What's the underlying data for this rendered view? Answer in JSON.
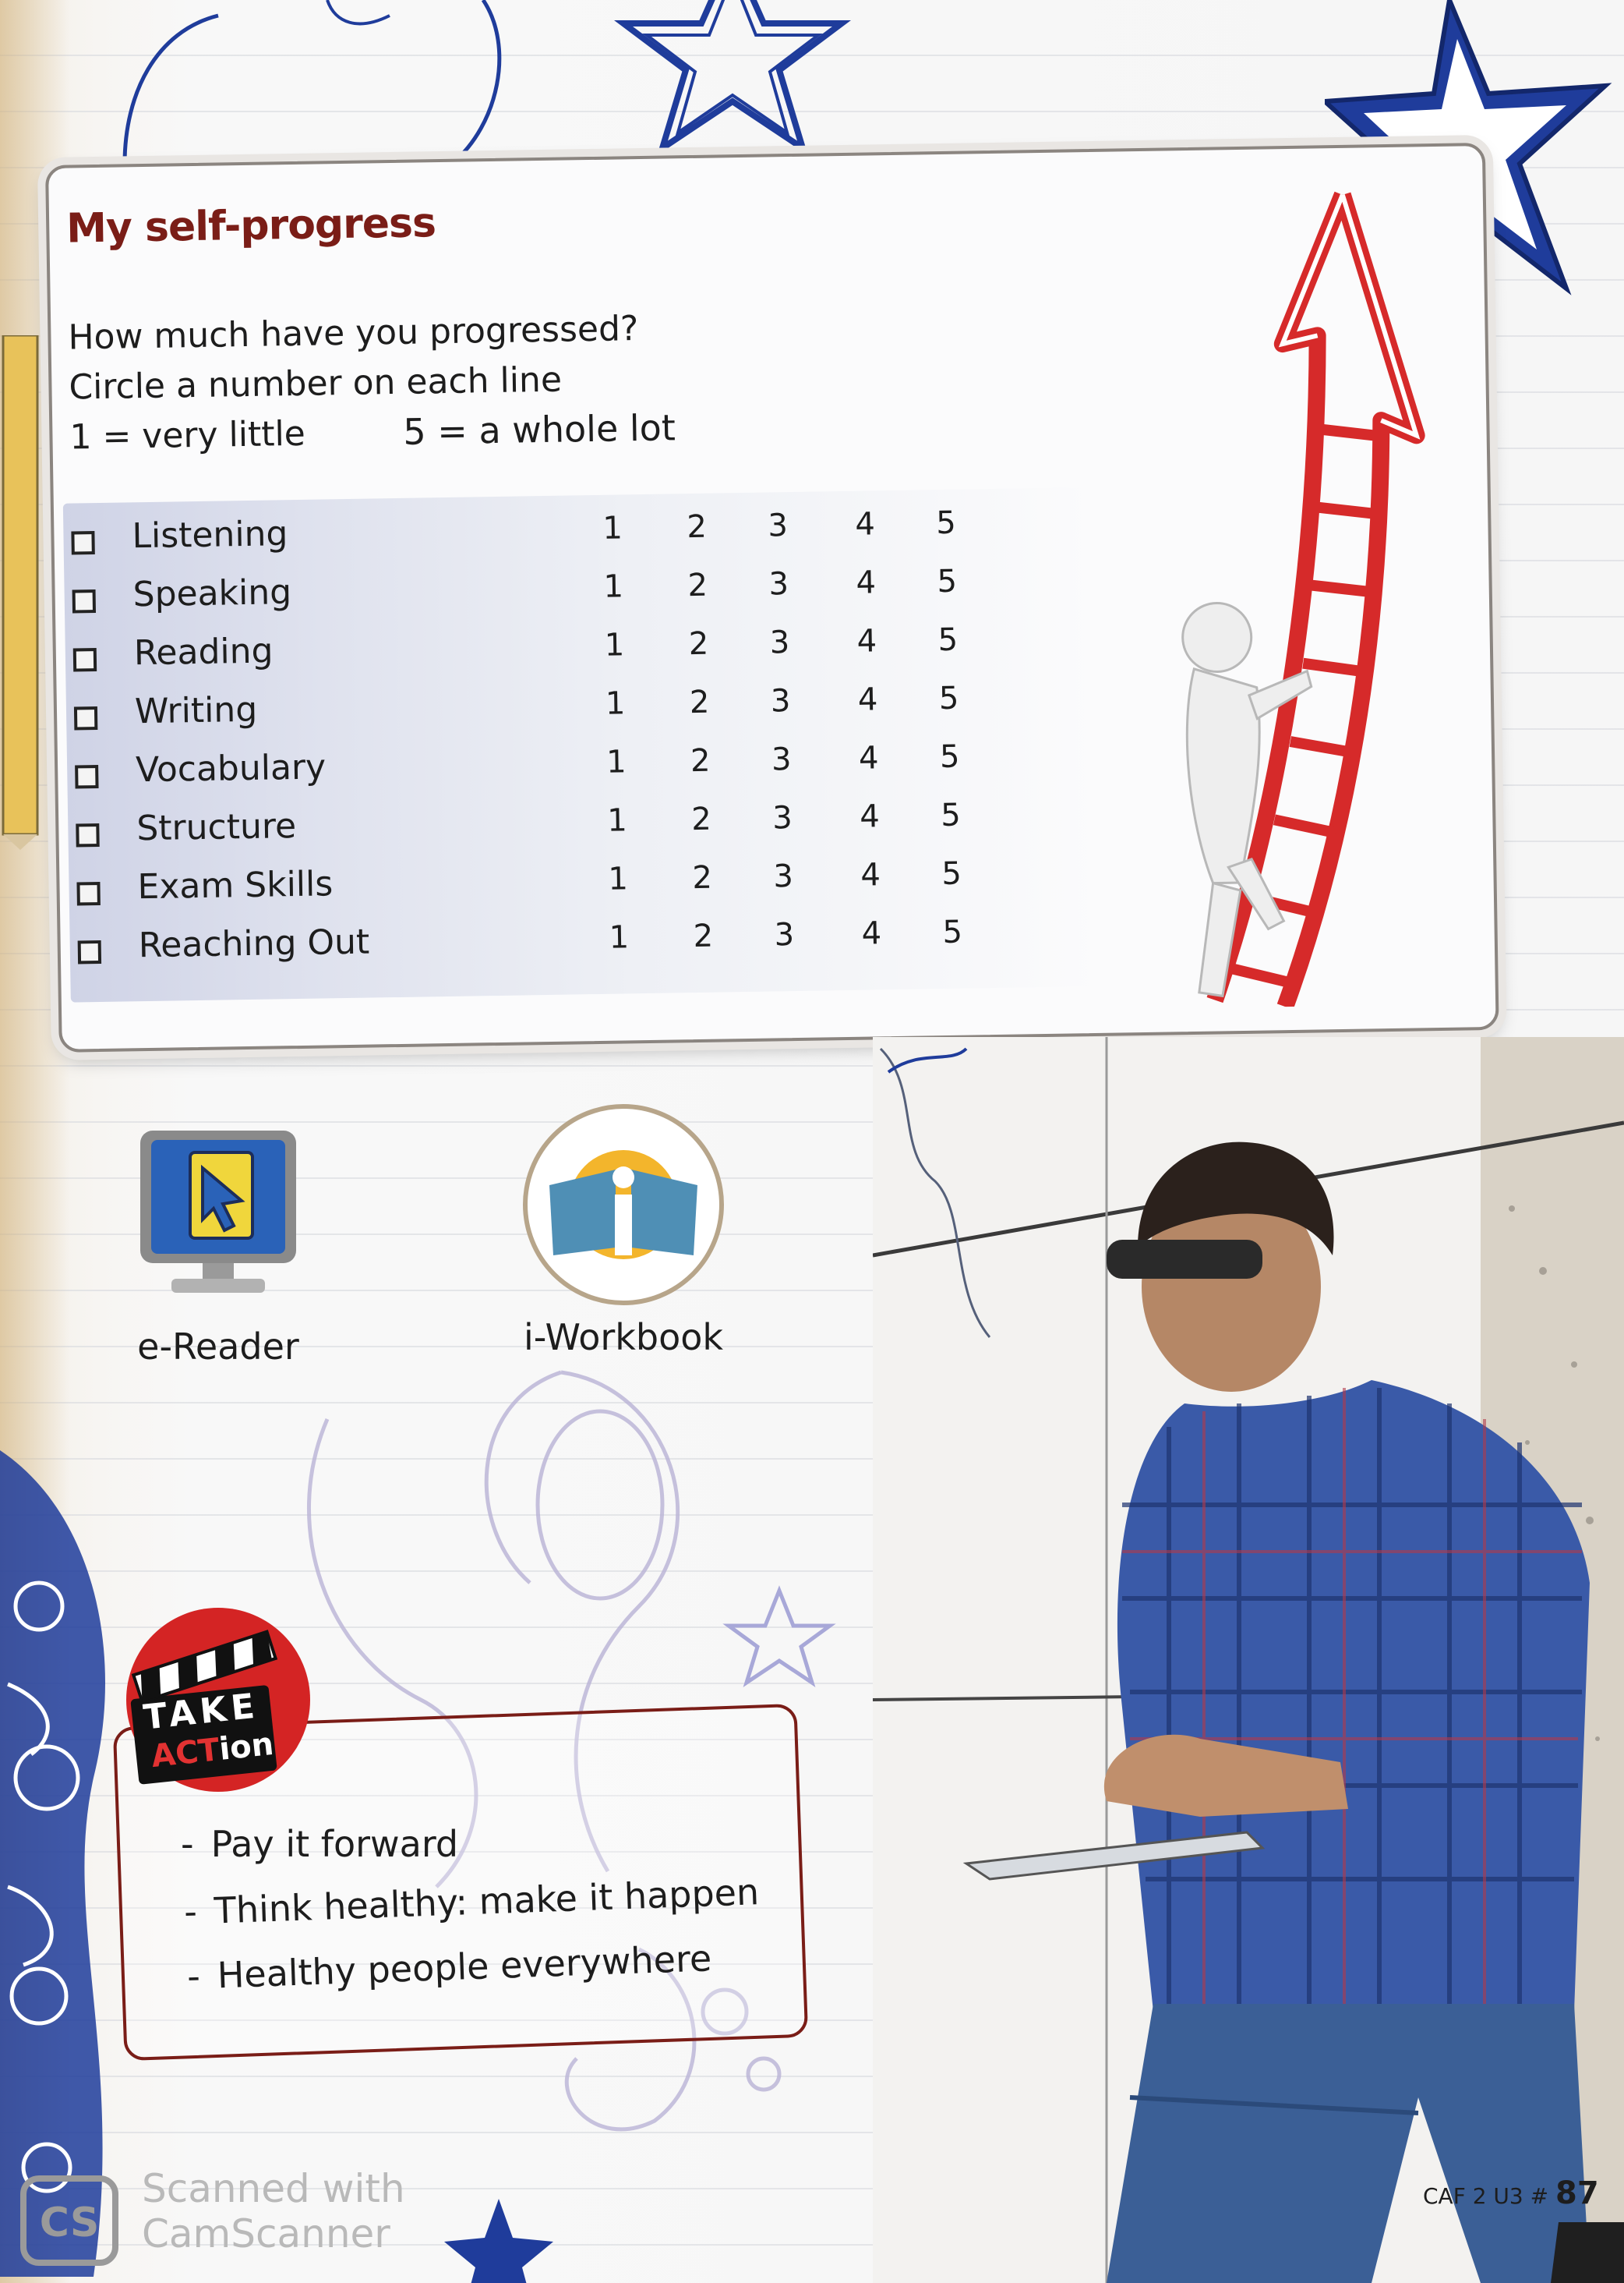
{
  "self_progress": {
    "title": "My self-progress",
    "question": "How much have you progressed?",
    "instruction": "Circle a number on each line",
    "scale_low": "1 = very little",
    "scale_high": "5 = a whole lot",
    "scale_numbers": [
      "1",
      "2",
      "3",
      "4",
      "5"
    ],
    "skills": [
      "Listening",
      "Speaking",
      "Reading",
      "Writing",
      "Vocabulary",
      "Structure",
      "Exam Skills",
      "Reaching Out"
    ]
  },
  "apps": {
    "ereader_label": "e-Reader",
    "iworkbook_label": "i-Workbook"
  },
  "take_action": {
    "badge_top": "TAKE",
    "badge_act": "ACT",
    "badge_ion": "ion",
    "items": [
      "Pay it forward",
      "Think healthy: make it happen",
      "Healthy people everywhere"
    ]
  },
  "footer": {
    "watermark_line1": "Scanned with",
    "watermark_line2": "CamScanner",
    "page_ref": "CAF 2 U3 #",
    "page_number": "87"
  },
  "colors": {
    "title": "#7a1d17",
    "arrow": "#d62a2a",
    "star_blue": "#1f3c9b"
  }
}
